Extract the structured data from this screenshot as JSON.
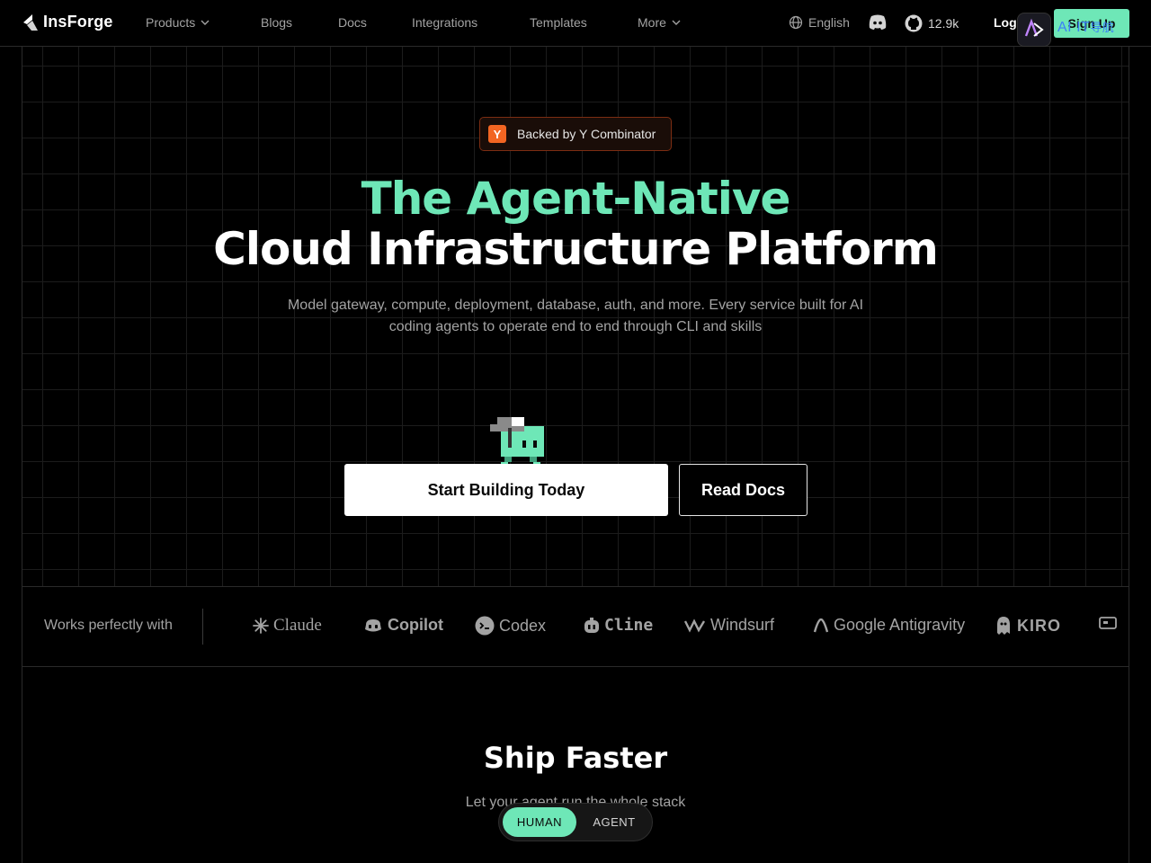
{
  "nav": {
    "brand": "InsForge",
    "links": [
      "Products",
      "Blogs",
      "Docs",
      "Integrations",
      "Templates",
      "More"
    ],
    "language": "English",
    "github_stars": "12.9k",
    "login": "Log",
    "signup": "Sign Up",
    "extension_text": "AI IT",
    "extension_text_cjk": "导航"
  },
  "hero": {
    "badge_logo": "Y",
    "badge_text": "Backed by Y Combinator",
    "headline_line1": "The Agent-Native",
    "headline_line2": "Cloud Infrastructure Platform",
    "subtitle": "Model gateway, compute, deployment, database, auth, and more. Every service built for AI coding agents to operate end to end through CLI and skills",
    "primary_cta": "Start Building Today",
    "secondary_cta": "Read Docs"
  },
  "integrations": {
    "label": "Works perfectly with",
    "partners": [
      "Claude",
      "Copilot",
      "Codex",
      "Cline",
      "Windsurf",
      "Google Antigravity",
      "KIRO"
    ]
  },
  "ship": {
    "title": "Ship Faster",
    "subtitle": "Let your agent run the whole stack",
    "toggle": [
      "HUMAN",
      "AGENT"
    ],
    "toggle_selected": "HUMAN"
  },
  "colors": {
    "accent": "#6ee7b7",
    "background": "#000000",
    "yc_orange": "#f26522"
  },
  "icons": [
    "chevron-down-icon",
    "globe-icon",
    "discord-icon",
    "github-icon",
    "claude-icon",
    "copilot-icon",
    "codex-icon",
    "cline-icon",
    "windsurf-icon",
    "antigravity-icon",
    "kiro-icon"
  ]
}
